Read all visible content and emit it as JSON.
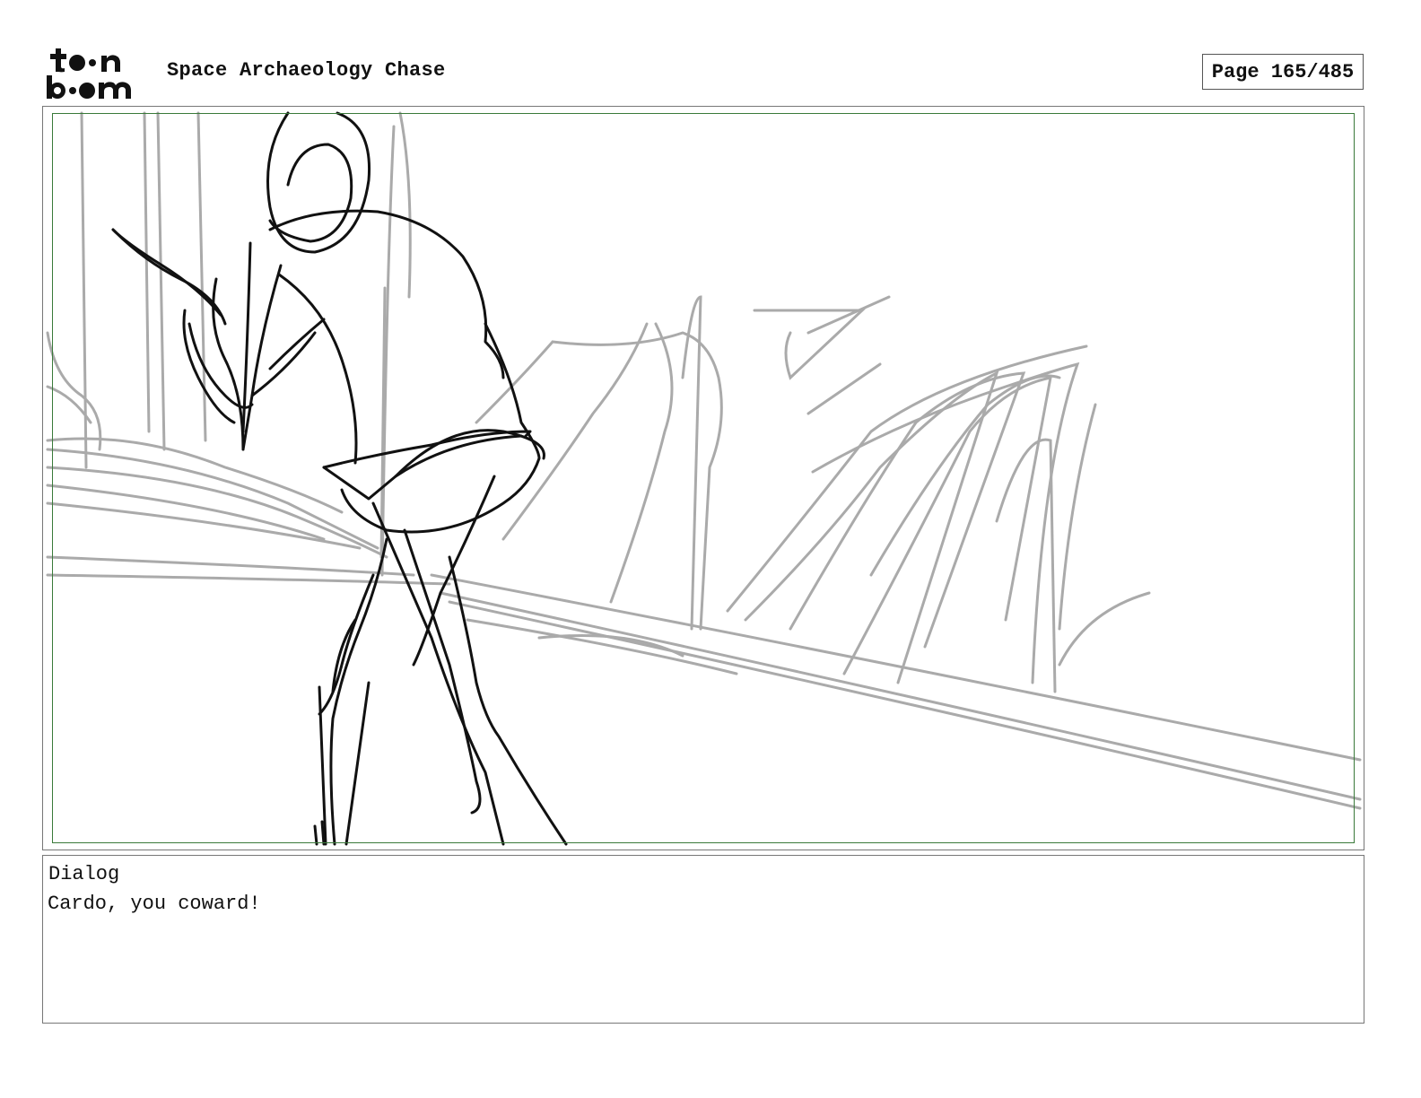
{
  "header": {
    "logo_text": "toon boom",
    "title": "Space Archaeology Chase",
    "page_indicator": "Page 165/485"
  },
  "panel": {
    "sketch_description_icon": "storyboard-sketch"
  },
  "dialog": {
    "label": "Dialog",
    "text": "Cardo, you coward!"
  },
  "colors": {
    "panel_border": "#777777",
    "safe_area": "#3a7a3a",
    "sketch_dark": "#111111",
    "sketch_light": "#aaaaaa"
  }
}
